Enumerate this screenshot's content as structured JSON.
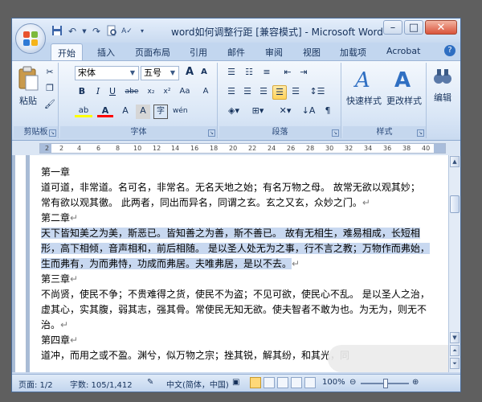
{
  "window": {
    "title": "word如何调整行距 [兼容模式] - Microsoft Word",
    "minimize": "–",
    "maximize": "□",
    "close": "✕"
  },
  "quick_access": [
    "save-icon",
    "undo-icon",
    "redo-icon",
    "print-preview-icon",
    "spelling-icon",
    "customize-icon"
  ],
  "tabs": [
    "开始",
    "插入",
    "页面布局",
    "引用",
    "邮件",
    "审阅",
    "视图",
    "加载项",
    "Acrobat"
  ],
  "active_tab": "开始",
  "help": "?",
  "ribbon": {
    "clipboard": {
      "label": "剪贴板",
      "paste": "粘贴"
    },
    "font": {
      "label": "字体",
      "font_name": "宋体",
      "font_size": "五号",
      "grow": "A",
      "shrink": "A",
      "clear": "A",
      "phonetic": "wén",
      "bold": "B",
      "italic": "I",
      "underline": "U",
      "strike": "abe",
      "subscript": "x₂",
      "superscript": "x²",
      "case": "Aa",
      "highlight": "ab",
      "font_color": "A",
      "char_shading": "A",
      "char_border": "A",
      "enclose": "字"
    },
    "paragraph": {
      "label": "段落"
    },
    "styles": {
      "label": "样式",
      "quick_styles": "快速样式",
      "change_styles": "更改样式"
    },
    "editing": {
      "label": "编辑"
    },
    "accent_color": "#2f6fc2",
    "highlight_color": "#ffff00",
    "font_color_bar": "#ff0000"
  },
  "ruler_numbers": [
    "2",
    "2",
    "4",
    "6",
    "8",
    "10",
    "12",
    "14",
    "16",
    "18",
    "20",
    "22",
    "24",
    "26",
    "28",
    "30",
    "32",
    "34",
    "36",
    "38",
    "40"
  ],
  "document": {
    "lines": [
      {
        "text": "第一章",
        "mark": "",
        "selected": false
      },
      {
        "text": "道可道，非常道。名可名，非常名。无名天地之始；有名万物之母。 故常无欲以观其妙；",
        "mark": "",
        "selected": false
      },
      {
        "text": "常有欲以观其徼。 此两者，同出而异名，同谓之玄。玄之又玄，众妙之门。",
        "mark": "↵",
        "selected": false
      },
      {
        "text": "第二章",
        "mark": "↵",
        "selected": false
      },
      {
        "text": "天下皆知美之为美，斯恶已。皆知善之为善，斯不善已。 故有无相生，难易相成，长短相",
        "mark": "",
        "selected": true
      },
      {
        "text": "形，高下相倾，音声相和，前后相随。 是以圣人处无为之事，行不言之教；万物作而弗始，",
        "mark": "",
        "selected": true
      },
      {
        "text": "生而弗有，为而弗恃，功成而弗居。夫唯弗居，是以不去。",
        "mark": "↵",
        "selected": true
      },
      {
        "text": "第三章",
        "mark": "↵",
        "selected": false
      },
      {
        "text": "不尚贤，使民不争；不贵难得之货，使民不为盗；不见可欲，使民心不乱。 是以圣人之治，",
        "mark": "",
        "selected": false
      },
      {
        "text": "虚其心，实其腹，弱其志，强其骨。常使民无知无欲。使夫智者不敢为也。为无为，则无不",
        "mark": "",
        "selected": false
      },
      {
        "text": "治。",
        "mark": "↵",
        "selected": false
      },
      {
        "text": "第四章",
        "mark": "↵",
        "selected": false
      },
      {
        "text": "道冲，而用之或不盈。渊兮，似万物之宗；挫其锐，解其纷，和其光，同",
        "mark": "",
        "selected": false
      }
    ]
  },
  "status_bar": {
    "page": "页面: 1/2",
    "words": "字数: 105/1,412",
    "language": "中文(简体，中国)",
    "zoom": "100%"
  }
}
